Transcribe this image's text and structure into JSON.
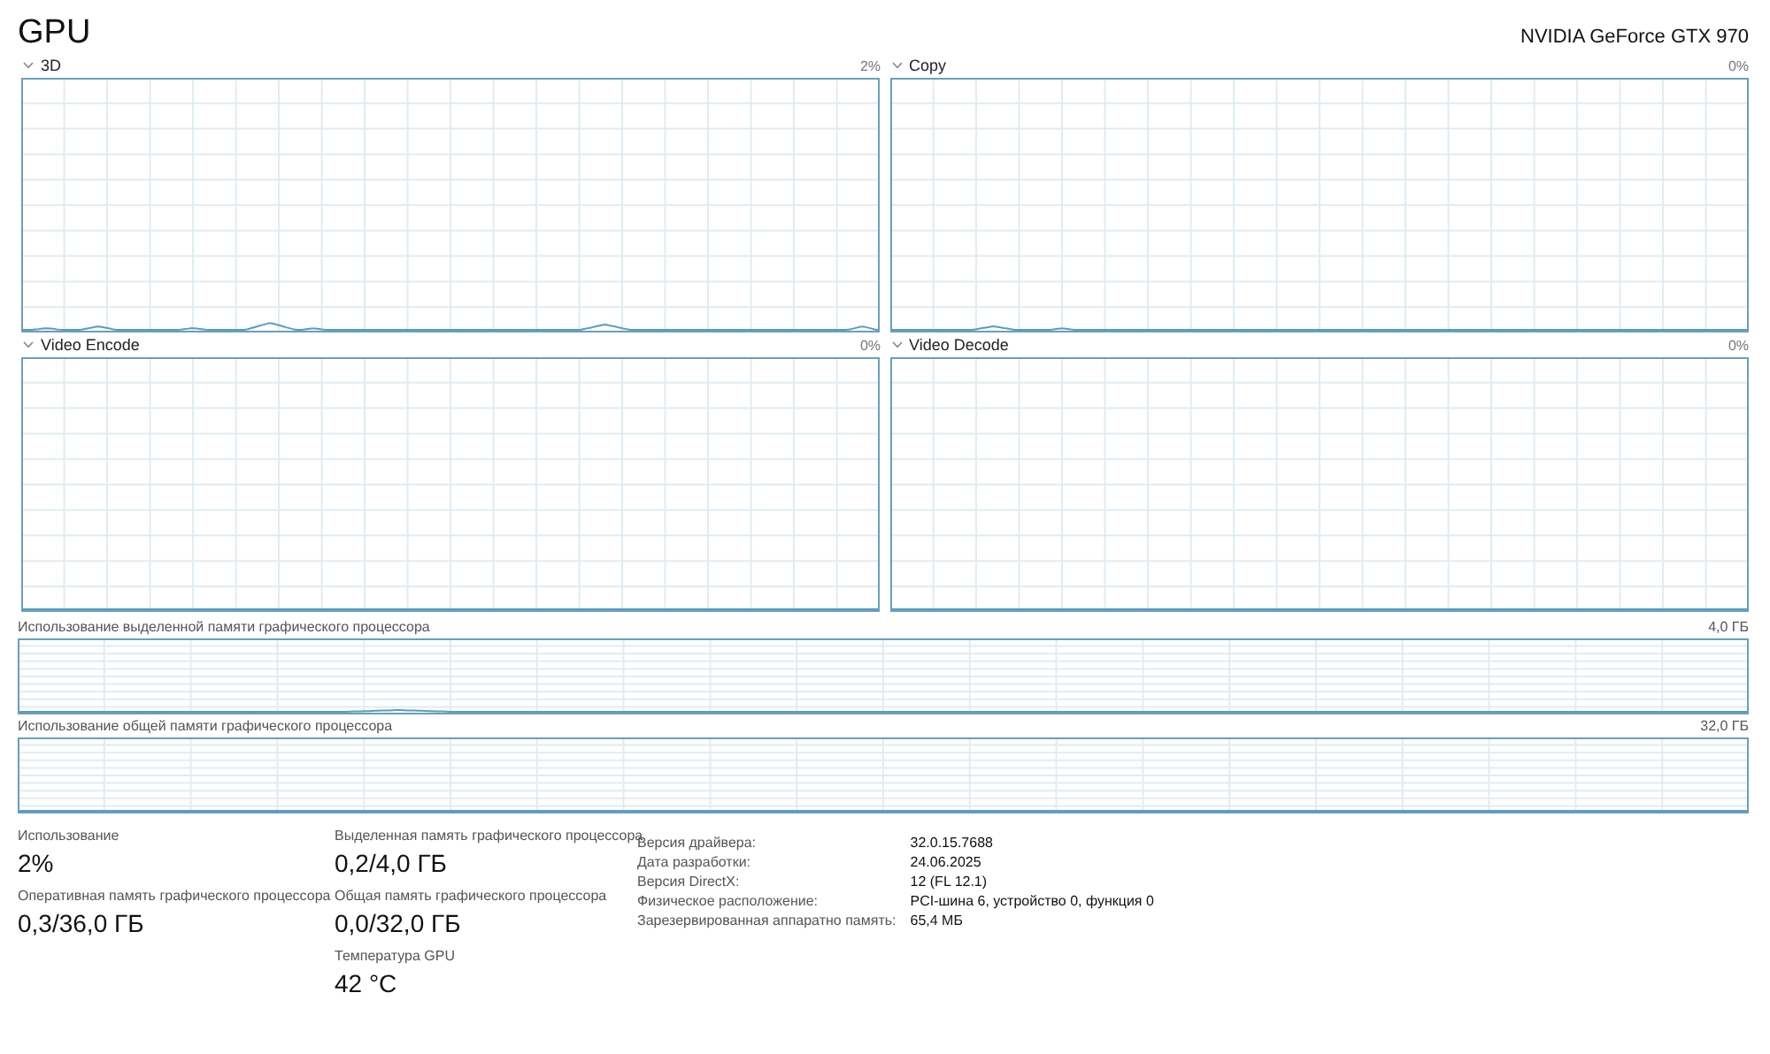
{
  "title": "GPU",
  "adapter": "NVIDIA GeForce GTX 970",
  "engines": [
    {
      "name": "3D",
      "reading": "2%"
    },
    {
      "name": "Copy",
      "reading": "0%"
    },
    {
      "name": "Video Encode",
      "reading": "0%"
    },
    {
      "name": "Video Decode",
      "reading": "0%"
    }
  ],
  "memory_graphs": [
    {
      "name": "Использование выделенной памяти графического процессора",
      "reading": "4,0 ГБ"
    },
    {
      "name": "Использование общей памяти графического процессора",
      "reading": "32,0 ГБ"
    }
  ],
  "stat_columns": [
    [
      {
        "label": "Использование",
        "value": "2%"
      },
      {
        "label": "Оперативная память графического процессора",
        "value": "0,3/36,0 ГБ"
      }
    ],
    [
      {
        "label": "Выделенная память графического процессора",
        "value": "0,2/4,0 ГБ"
      },
      {
        "label": "Общая память графического процессора",
        "value": "0,0/32,0 ГБ"
      },
      {
        "label": "Температура GPU",
        "value": "42 °C"
      }
    ]
  ],
  "properties": [
    {
      "label": "Версия драйвера:",
      "value": "32.0.15.7688"
    },
    {
      "label": "Дата разработки:",
      "value": "24.06.2025"
    },
    {
      "label": "Версия DirectX:",
      "value": "12 (FL 12.1)"
    },
    {
      "label": "Физическое расположение:",
      "value": "PCI-шина 6, устройство 0, функция 0"
    },
    {
      "label": "Зарезервированная аппаратно память:",
      "value": "65,4 МБ"
    }
  ]
}
